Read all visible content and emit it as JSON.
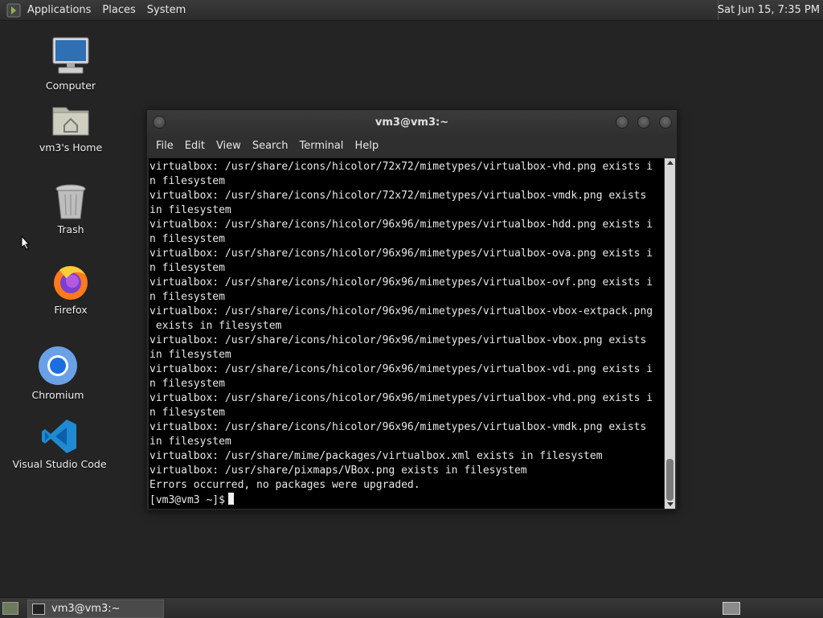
{
  "top_panel": {
    "menus": [
      "Applications",
      "Places",
      "System"
    ],
    "clock": "Sat Jun 15,  7:35 PM"
  },
  "desktop": {
    "icons": [
      {
        "label": "Computer",
        "icon": "computer-icon"
      },
      {
        "label": "vm3's Home",
        "icon": "home-folder-icon"
      },
      {
        "label": "Trash",
        "icon": "trash-icon"
      },
      {
        "label": "Firefox",
        "icon": "firefox-icon"
      },
      {
        "label": "Chromium",
        "icon": "chromium-icon"
      },
      {
        "label": "Visual Studio Code",
        "icon": "vscode-icon"
      }
    ]
  },
  "terminal": {
    "title": "vm3@vm3:~",
    "menus": [
      "File",
      "Edit",
      "View",
      "Search",
      "Terminal",
      "Help"
    ],
    "lines": [
      "virtualbox: /usr/share/icons/hicolor/72x72/mimetypes/virtualbox-vhd.png exists i",
      "n filesystem",
      "virtualbox: /usr/share/icons/hicolor/72x72/mimetypes/virtualbox-vmdk.png exists",
      "in filesystem",
      "virtualbox: /usr/share/icons/hicolor/96x96/mimetypes/virtualbox-hdd.png exists i",
      "n filesystem",
      "virtualbox: /usr/share/icons/hicolor/96x96/mimetypes/virtualbox-ova.png exists i",
      "n filesystem",
      "virtualbox: /usr/share/icons/hicolor/96x96/mimetypes/virtualbox-ovf.png exists i",
      "n filesystem",
      "virtualbox: /usr/share/icons/hicolor/96x96/mimetypes/virtualbox-vbox-extpack.png",
      " exists in filesystem",
      "virtualbox: /usr/share/icons/hicolor/96x96/mimetypes/virtualbox-vbox.png exists",
      "in filesystem",
      "virtualbox: /usr/share/icons/hicolor/96x96/mimetypes/virtualbox-vdi.png exists i",
      "n filesystem",
      "virtualbox: /usr/share/icons/hicolor/96x96/mimetypes/virtualbox-vhd.png exists i",
      "n filesystem",
      "virtualbox: /usr/share/icons/hicolor/96x96/mimetypes/virtualbox-vmdk.png exists",
      "in filesystem",
      "virtualbox: /usr/share/mime/packages/virtualbox.xml exists in filesystem",
      "virtualbox: /usr/share/pixmaps/VBox.png exists in filesystem",
      "Errors occurred, no packages were upgraded."
    ],
    "prompt": "[vm3@vm3 ~]$"
  },
  "bottom_panel": {
    "task_label": "vm3@vm3:~"
  },
  "colors": {
    "desktop_bg": "#242424",
    "terminal_bg": "#000000",
    "terminal_fg": "#e8e8e8"
  }
}
